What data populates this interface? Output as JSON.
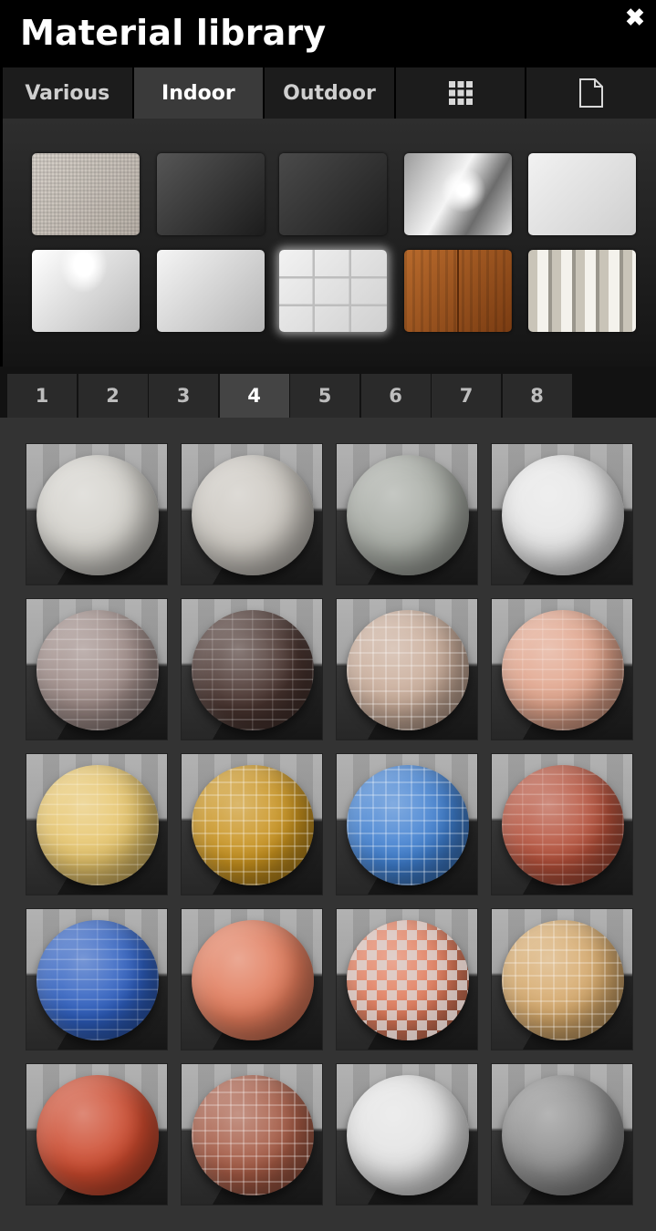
{
  "window": {
    "title": "Material library",
    "close_glyph": "✖"
  },
  "tabs": [
    {
      "label": "Various",
      "active": false
    },
    {
      "label": "Indoor",
      "active": true
    },
    {
      "label": "Outdoor",
      "active": false
    },
    {
      "icon": "grid-icon"
    },
    {
      "icon": "document-icon"
    }
  ],
  "swatches": [
    {
      "name": "fabric",
      "colors": [
        "#d8d2cb",
        "#b9b1a8"
      ]
    },
    {
      "name": "dark-glossy",
      "colors": [
        "#565656",
        "#1c1c1c"
      ]
    },
    {
      "name": "leather",
      "colors": [
        "#4a4a4a",
        "#1e1e1e"
      ]
    },
    {
      "name": "brushed-metal",
      "colors": [
        "#f0f0f0",
        "#7a7a7a"
      ]
    },
    {
      "name": "white-stucco",
      "colors": [
        "#f2f2f2",
        "#cfcfcf"
      ]
    },
    {
      "name": "white-gloss",
      "colors": [
        "#ffffff",
        "#b8b8b8"
      ]
    },
    {
      "name": "marble",
      "colors": [
        "#f5f5f5",
        "#b5b5b5"
      ]
    },
    {
      "name": "white-tiles",
      "colors": [
        "#f2f2f2",
        "#d0d0d0"
      ],
      "selected": true
    },
    {
      "name": "wood-floor",
      "colors": [
        "#b86a2c",
        "#7a3c12"
      ]
    },
    {
      "name": "curtain",
      "colors": [
        "#d9d6ce",
        "#9fb3c0"
      ]
    }
  ],
  "pages": [
    {
      "label": "1"
    },
    {
      "label": "2"
    },
    {
      "label": "3"
    },
    {
      "label": "4",
      "active": true
    },
    {
      "label": "5"
    },
    {
      "label": "6"
    },
    {
      "label": "7"
    },
    {
      "label": "8"
    }
  ],
  "materials": [
    {
      "name": "light-grey-stone-tiles",
      "color": "#d3d1cb",
      "pattern": "none"
    },
    {
      "name": "beige-grey-tiles",
      "color": "#cbc7c0",
      "pattern": "none"
    },
    {
      "name": "grey-green-tiles",
      "color": "#a6aaa3",
      "pattern": "none"
    },
    {
      "name": "white-stone-tiles",
      "color": "#e6e6e6",
      "pattern": "none"
    },
    {
      "name": "mauve-brick-tiles",
      "color": "#9d8a86",
      "pattern": "brick"
    },
    {
      "name": "dark-brown-brick-tiles",
      "color": "#4a3530",
      "pattern": "brick"
    },
    {
      "name": "beige-cobble-tiles",
      "color": "#c8ab98",
      "pattern": "grid"
    },
    {
      "name": "salmon-brick-tiles",
      "color": "#e0a38a",
      "pattern": "brick"
    },
    {
      "name": "yellow-mosaic-tiles",
      "color": "#e6c46a",
      "pattern": "brick"
    },
    {
      "name": "amber-mosaic-tiles",
      "color": "#c8921e",
      "pattern": "grid"
    },
    {
      "name": "blue-mosaic-tiles",
      "color": "#3f7fd0",
      "pattern": "grid"
    },
    {
      "name": "red-brick-tiles",
      "color": "#b4503a",
      "pattern": "brick"
    },
    {
      "name": "blue-brick-tiles",
      "color": "#2e5fc0",
      "pattern": "brick"
    },
    {
      "name": "terracotta-plain",
      "color": "#e07a5a",
      "pattern": "none"
    },
    {
      "name": "orange-checker-tiles",
      "color": "#e07a5a",
      "pattern": "checker"
    },
    {
      "name": "sand-tiles",
      "color": "#d5a86a",
      "pattern": "grid"
    },
    {
      "name": "red-crazy-paving",
      "color": "#cc4a2e",
      "pattern": "none"
    },
    {
      "name": "brown-terracotta-tiles",
      "color": "#a55a44",
      "pattern": "grid"
    },
    {
      "name": "white-tiles-plain",
      "color": "#e3e3e3",
      "pattern": "none"
    },
    {
      "name": "grey-plain",
      "color": "#8e8e8e",
      "pattern": "none"
    }
  ]
}
